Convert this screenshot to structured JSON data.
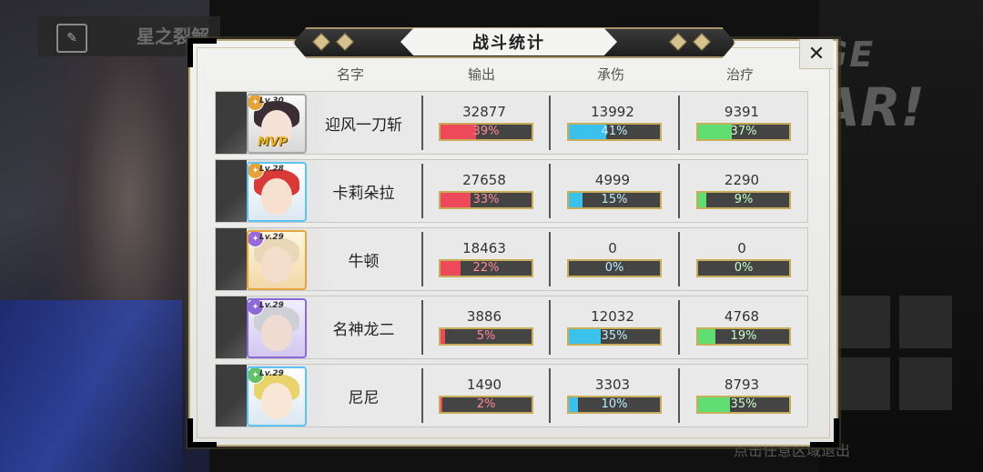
{
  "background": {
    "screen_title": "星之裂解",
    "banner_line1": "GE",
    "banner_line2": "AR!",
    "hint": "点击任意区域退出"
  },
  "dialog": {
    "title": "战斗统计",
    "close_label": "✕",
    "headers": {
      "name": "名字",
      "damage": "输出",
      "tank": "承伤",
      "heal": "治疗"
    }
  },
  "players": [
    {
      "level": "Lv.30",
      "name": "迎风一刀斩",
      "mvp": "MVP",
      "frame": "silver",
      "damage": {
        "value": "32877",
        "pct": "39%",
        "fraction": 0.39
      },
      "tank": {
        "value": "13992",
        "pct": "41%",
        "fraction": 0.41
      },
      "heal": {
        "value": "9391",
        "pct": "37%",
        "fraction": 0.37
      }
    },
    {
      "level": "Lv.28",
      "name": "卡莉朵拉",
      "mvp": "",
      "frame": "blue",
      "damage": {
        "value": "27658",
        "pct": "33%",
        "fraction": 0.33
      },
      "tank": {
        "value": "4999",
        "pct": "15%",
        "fraction": 0.15
      },
      "heal": {
        "value": "2290",
        "pct": "9%",
        "fraction": 0.09
      }
    },
    {
      "level": "Lv.29",
      "name": "牛顿",
      "mvp": "",
      "frame": "gold",
      "damage": {
        "value": "18463",
        "pct": "22%",
        "fraction": 0.22
      },
      "tank": {
        "value": "0",
        "pct": "0%",
        "fraction": 0.0
      },
      "heal": {
        "value": "0",
        "pct": "0%",
        "fraction": 0.0
      }
    },
    {
      "level": "Lv.29",
      "name": "名神龙二",
      "mvp": "",
      "frame": "purple",
      "damage": {
        "value": "3886",
        "pct": "5%",
        "fraction": 0.05
      },
      "tank": {
        "value": "12032",
        "pct": "35%",
        "fraction": 0.35
      },
      "heal": {
        "value": "4768",
        "pct": "19%",
        "fraction": 0.19
      }
    },
    {
      "level": "Lv.29",
      "name": "尼尼",
      "mvp": "",
      "frame": "blue",
      "damage": {
        "value": "1490",
        "pct": "2%",
        "fraction": 0.02
      },
      "tank": {
        "value": "3303",
        "pct": "10%",
        "fraction": 0.1
      },
      "heal": {
        "value": "8793",
        "pct": "35%",
        "fraction": 0.35
      }
    }
  ],
  "colors": {
    "damage": "#ec4a5a",
    "tank": "#3bc2ec",
    "heal": "#60de72",
    "frame_gold": "#c8ae58"
  }
}
